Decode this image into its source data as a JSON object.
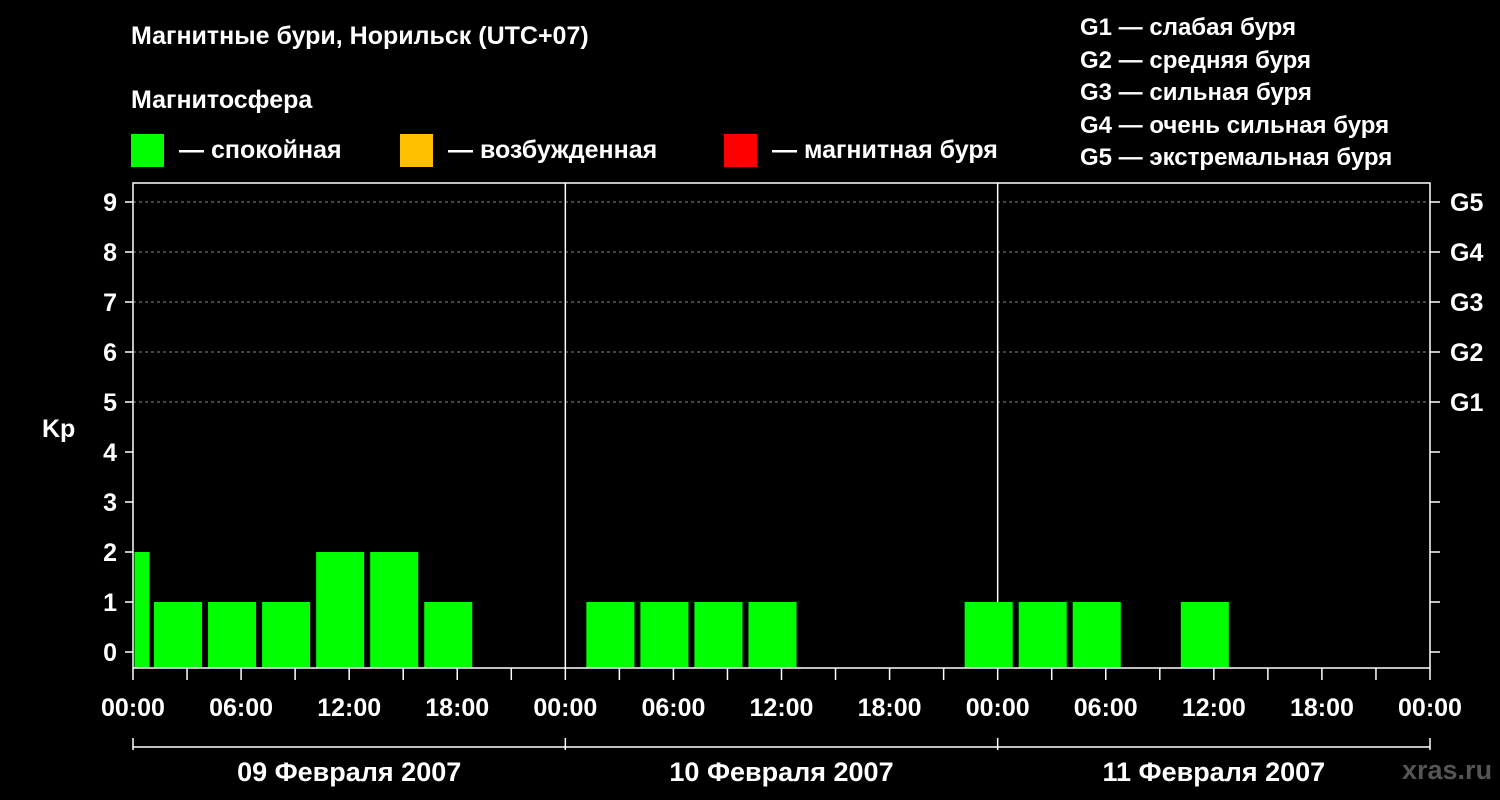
{
  "title": "Магнитные бури, Норильск (UTC+07)",
  "subtitle": "Магнитосфера",
  "legend": [
    {
      "label": "— спокойная",
      "color": "#00ff00"
    },
    {
      "label": "— возбужденная",
      "color": "#ffc000"
    },
    {
      "label": "— магнитная буря",
      "color": "#ff0000"
    }
  ],
  "g_legend": [
    "G1 — слабая буря",
    "G2 — средняя буря",
    "G3 — сильная буря",
    "G4 — очень сильная буря",
    "G5 — экстремальная буря"
  ],
  "watermark": "xras.ru",
  "chart_data": {
    "type": "bar",
    "ylabel": "Kp",
    "ylim": [
      0,
      9
    ],
    "y_ticks": [
      "0",
      "1",
      "2",
      "3",
      "4",
      "5",
      "6",
      "7",
      "8",
      "9"
    ],
    "right_ticks": [
      {
        "value": 5,
        "label": "G1"
      },
      {
        "value": 6,
        "label": "G2"
      },
      {
        "value": 7,
        "label": "G3"
      },
      {
        "value": 8,
        "label": "G4"
      },
      {
        "value": 9,
        "label": "G5"
      }
    ],
    "grid": "dashed at Kp 5–9",
    "x_tick_labels": [
      "00:00",
      "06:00",
      "12:00",
      "18:00",
      "00:00",
      "06:00",
      "12:00",
      "18:00",
      "00:00",
      "06:00",
      "12:00",
      "18:00",
      "00:00"
    ],
    "days": [
      "09 Февраля 2007",
      "10 Февраля 2007",
      "11 Февраля 2007"
    ],
    "bars": [
      {
        "day": 0,
        "start": "00:00",
        "end": "01:00",
        "kp": 2
      },
      {
        "day": 0,
        "start": "01:00",
        "end": "04:00",
        "kp": 1
      },
      {
        "day": 0,
        "start": "04:00",
        "end": "07:00",
        "kp": 1
      },
      {
        "day": 0,
        "start": "07:00",
        "end": "10:00",
        "kp": 1
      },
      {
        "day": 0,
        "start": "10:00",
        "end": "13:00",
        "kp": 2
      },
      {
        "day": 0,
        "start": "13:00",
        "end": "16:00",
        "kp": 2
      },
      {
        "day": 0,
        "start": "16:00",
        "end": "19:00",
        "kp": 1
      },
      {
        "day": 1,
        "start": "01:00",
        "end": "04:00",
        "kp": 1
      },
      {
        "day": 1,
        "start": "04:00",
        "end": "07:00",
        "kp": 1
      },
      {
        "day": 1,
        "start": "07:00",
        "end": "10:00",
        "kp": 1
      },
      {
        "day": 1,
        "start": "10:00",
        "end": "13:00",
        "kp": 1
      },
      {
        "day": 1,
        "start": "22:00",
        "end": "01:00",
        "kp": 1
      },
      {
        "day": 2,
        "start": "01:00",
        "end": "04:00",
        "kp": 1
      },
      {
        "day": 2,
        "start": "04:00",
        "end": "07:00",
        "kp": 1
      },
      {
        "day": 2,
        "start": "10:00",
        "end": "13:00",
        "kp": 1
      }
    ],
    "bar_color": "#00ff00"
  }
}
